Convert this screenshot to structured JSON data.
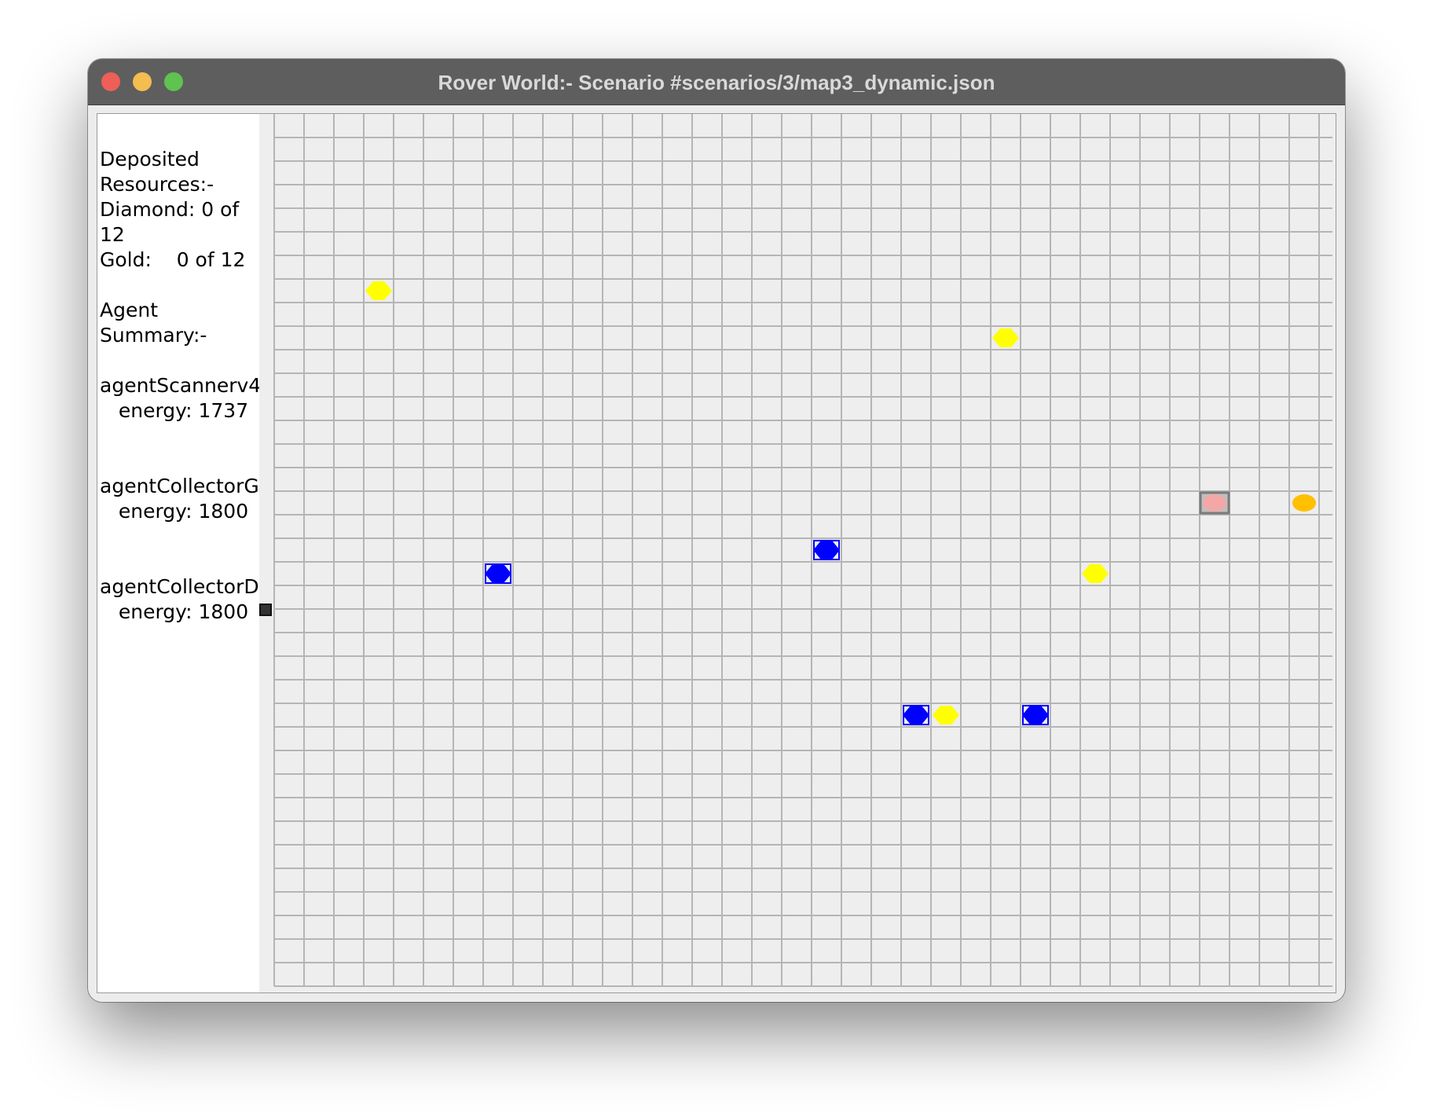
{
  "window": {
    "title": "Rover World:- Scenario #scenarios/3/map3_dynamic.json"
  },
  "sidebar": {
    "lines": [
      "Deposited",
      "Resources:-",
      "Diamond: 0 of",
      "12",
      "Gold:    0 of 12",
      "",
      "Agent",
      "Summary:-",
      "",
      "agentScannerv4:",
      "   energy: 1737",
      "",
      "",
      "agentCollectorG",
      "   energy: 1800",
      "",
      "",
      "agentCollectorD",
      "   energy: 1800"
    ]
  },
  "grid": {
    "columns": 36,
    "rows": 37,
    "line_color": "#b5b5b5",
    "background_color": "#eeeeee",
    "entities": [
      {
        "type": "gold",
        "icon": "gold-diamond-icon",
        "col": 3,
        "row": 6,
        "color": "#ffff00"
      },
      {
        "type": "gold",
        "icon": "gold-diamond-icon",
        "col": 24,
        "row": 8,
        "color": "#ffff00"
      },
      {
        "type": "gold",
        "icon": "gold-diamond-icon",
        "col": 27,
        "row": 18,
        "color": "#ffff00"
      },
      {
        "type": "gold",
        "icon": "gold-diamond-icon",
        "col": 22,
        "row": 24,
        "color": "#ffff00"
      },
      {
        "type": "diamond",
        "icon": "blue-diamond-icon",
        "col": 7,
        "row": 18,
        "color": "#0000ff"
      },
      {
        "type": "diamond",
        "icon": "blue-diamond-icon",
        "col": 18,
        "row": 17,
        "color": "#0000ff"
      },
      {
        "type": "diamond",
        "icon": "blue-diamond-icon",
        "col": 21,
        "row": 24,
        "color": "#0000ff"
      },
      {
        "type": "diamond",
        "icon": "blue-diamond-icon",
        "col": 25,
        "row": 24,
        "color": "#0000ff"
      },
      {
        "type": "agent",
        "icon": "pink-agent-icon",
        "col": 31,
        "row": 15,
        "color": "#f4a7a7"
      },
      {
        "type": "agent",
        "icon": "orange-agent-icon",
        "col": 34,
        "row": 15,
        "color": "#ffc000"
      }
    ],
    "marker_color": "#333333"
  }
}
